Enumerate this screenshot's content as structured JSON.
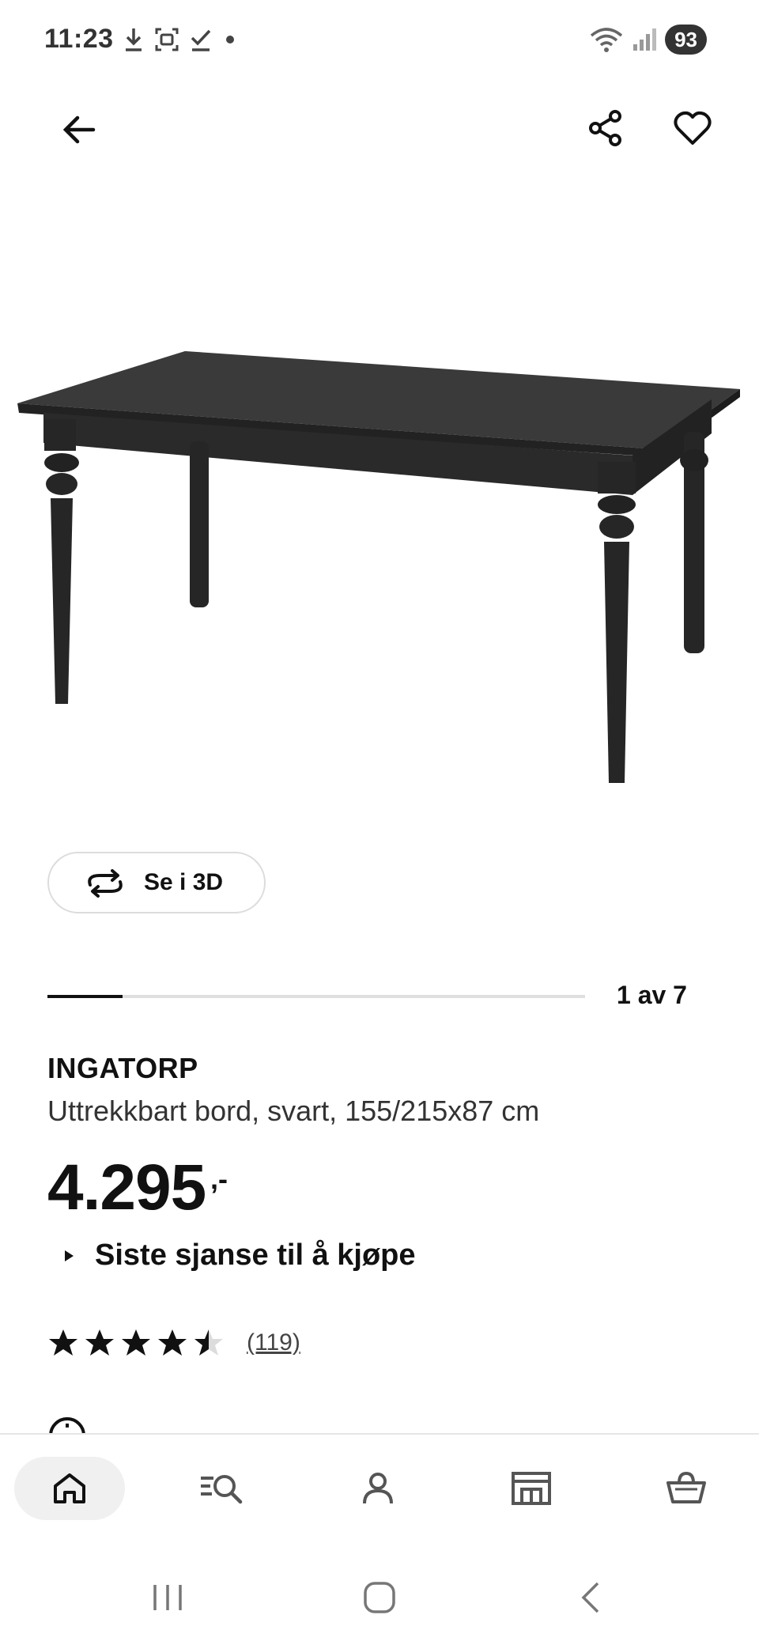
{
  "status_bar": {
    "time": "11:23",
    "battery": "93",
    "icons_left": [
      "download-icon",
      "screenshot-icon",
      "check-icon",
      "dot-icon"
    ],
    "icons_right": [
      "wifi-icon",
      "signal-icon"
    ]
  },
  "top_bar": {
    "icons": [
      "back-arrow-icon",
      "share-icon",
      "heart-icon"
    ]
  },
  "view_3d": {
    "label": "Se i 3D"
  },
  "carousel": {
    "counter": "1 av 7",
    "progress": 0.14
  },
  "product": {
    "name": "INGATORP",
    "description": "Uttrekkbart bord, svart, 155/215x87 cm",
    "price": "4.295",
    "price_suffix": ",-",
    "notice": "Siste sjanse til å kjøpe"
  },
  "rating": {
    "stars": 4.5,
    "max": 5,
    "count": "(119)"
  },
  "bottom_nav": {
    "items": [
      "home-icon",
      "search-icon",
      "profile-icon",
      "store-icon",
      "basket-icon"
    ],
    "active": "home-icon"
  },
  "system_nav": {
    "icons": [
      "recents-icon",
      "home-button-icon",
      "back-icon"
    ]
  },
  "colors": {
    "accent": "#111111",
    "track": "#dfdfdf",
    "nav_active_bg": "#f0f0f0",
    "table": "#2b2b2b"
  }
}
